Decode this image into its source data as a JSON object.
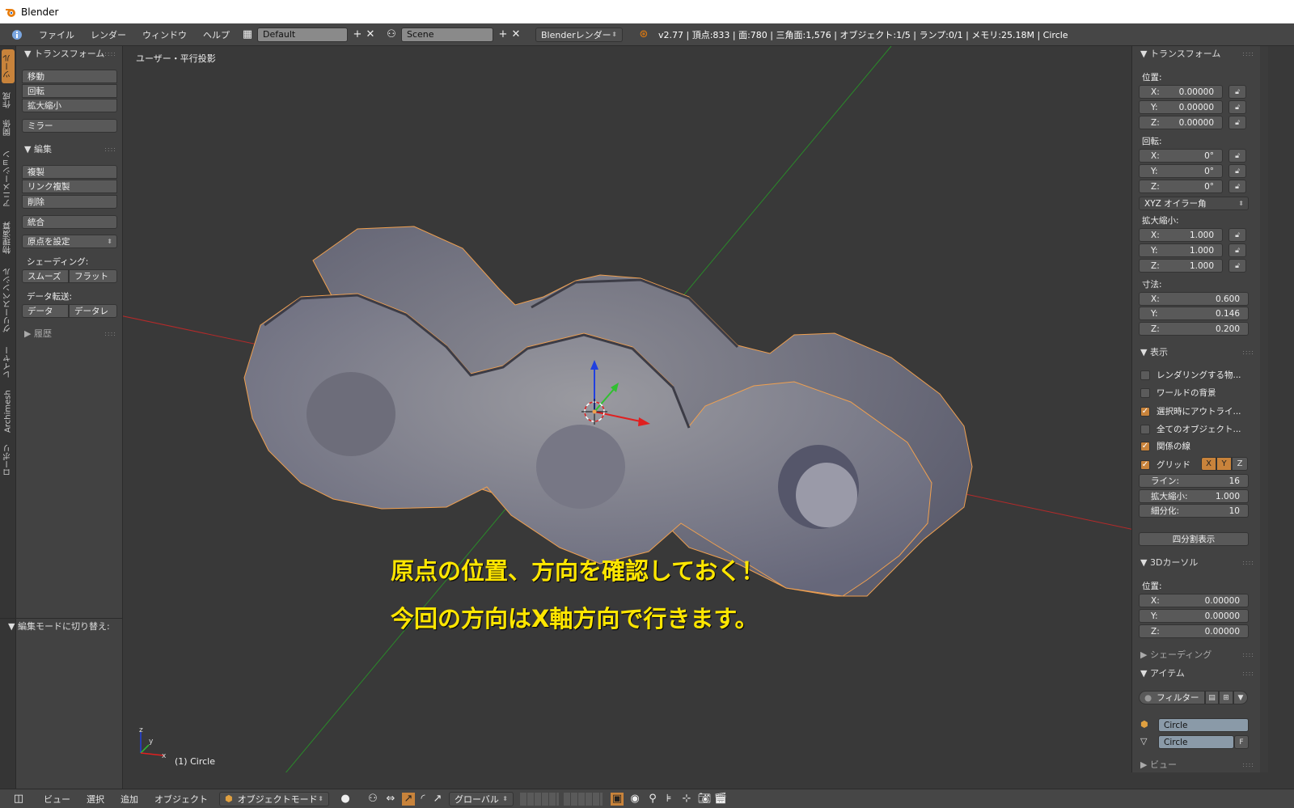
{
  "window": {
    "title": "Blender"
  },
  "topbar": {
    "menus": [
      "ファイル",
      "レンダー",
      "ウィンドウ",
      "ヘルプ"
    ],
    "layout": "Default",
    "scene": "Scene",
    "engine": "Blenderレンダー",
    "info": "v2.77 | 頂点:833 | 面:780 | 三角面:1,576 | オブジェクト:1/5 | ランプ:0/1 | メモリ:25.18M | Circle"
  },
  "left_tabs": [
    "ツール",
    "作成",
    "関係",
    "アニメーション",
    "物理演算",
    "グリースペンシル",
    "レイヤー",
    "Archimesh",
    "ローポリ"
  ],
  "tool_panel": {
    "transform_header": "トランスフォーム",
    "move": "移動",
    "rotate": "回転",
    "scale": "拡大縮小",
    "mirror": "ミラー",
    "edit_header": "編集",
    "duplicate": "複製",
    "link_duplicate": "リンク複製",
    "delete": "削除",
    "join": "統合",
    "set_origin": "原点を設定",
    "shading_label": "シェーディング:",
    "smooth": "スムーズ",
    "flat": "フラット",
    "data_transfer_label": "データ転送:",
    "data": "データ",
    "data_layout": "データレ",
    "history_header": "履歴",
    "edit_mode_toggle": "編集モードに切り替え:"
  },
  "viewport": {
    "view_label": "ユーザー・平行投影",
    "object_label": "(1) Circle",
    "annotation_1": "原点の位置、方向を確認しておく！",
    "annotation_2": "今回の方向はX軸方向で行きます。",
    "axis_x": "x",
    "axis_y": "y",
    "axis_z": "z"
  },
  "right_panel": {
    "transform_header": "トランスフォーム",
    "location_label": "位置:",
    "loc": [
      {
        "a": "X:",
        "v": "0.00000"
      },
      {
        "a": "Y:",
        "v": "0.00000"
      },
      {
        "a": "Z:",
        "v": "0.00000"
      }
    ],
    "rotation_label": "回転:",
    "rot": [
      {
        "a": "X:",
        "v": "0°"
      },
      {
        "a": "Y:",
        "v": "0°"
      },
      {
        "a": "Z:",
        "v": "0°"
      }
    ],
    "rotation_mode": "XYZ オイラー角",
    "scale_label": "拡大縮小:",
    "scale": [
      {
        "a": "X:",
        "v": "1.000"
      },
      {
        "a": "Y:",
        "v": "1.000"
      },
      {
        "a": "Z:",
        "v": "1.000"
      }
    ],
    "dimensions_label": "寸法:",
    "dim": [
      {
        "a": "X:",
        "v": "0.600"
      },
      {
        "a": "Y:",
        "v": "0.146"
      },
      {
        "a": "Z:",
        "v": "0.200"
      }
    ],
    "display_header": "表示",
    "checks": [
      {
        "label": "レンダリングする物...",
        "on": false
      },
      {
        "label": "ワールドの背景",
        "on": false
      },
      {
        "label": "選択時にアウトライ...",
        "on": true
      },
      {
        "label": "全てのオブジェクト...",
        "on": false
      },
      {
        "label": "関係の線",
        "on": true
      }
    ],
    "grid_label": "グリッド",
    "grid_x": "X",
    "grid_y": "Y",
    "grid_z": "Z",
    "lines_label": "ライン:",
    "lines_value": "16",
    "grid_scale_label": "拡大縮小:",
    "grid_scale_value": "1.000",
    "subdiv_label": "細分化:",
    "subdiv_value": "10",
    "quad_view": "四分割表示",
    "cursor_header": "3Dカーソル",
    "cursor_location_label": "位置:",
    "cursor": [
      {
        "a": "X:",
        "v": "0.00000"
      },
      {
        "a": "Y:",
        "v": "0.00000"
      },
      {
        "a": "Z:",
        "v": "0.00000"
      }
    ],
    "shading_header": "シェーディング",
    "item_header": "アイテム",
    "filter_label": "フィルター",
    "object_name": "Circle",
    "mesh_name": "Circle",
    "fake_user": "F",
    "view_header": "ビュー"
  },
  "bottombar": {
    "menus": [
      "ビュー",
      "選択",
      "追加",
      "オブジェクト"
    ],
    "mode": "オブジェクトモード",
    "orientation": "グローバル"
  },
  "colors": {
    "accent": "#c8833b",
    "annotation": "#ffe600",
    "selection_outline": "#f0a050"
  }
}
